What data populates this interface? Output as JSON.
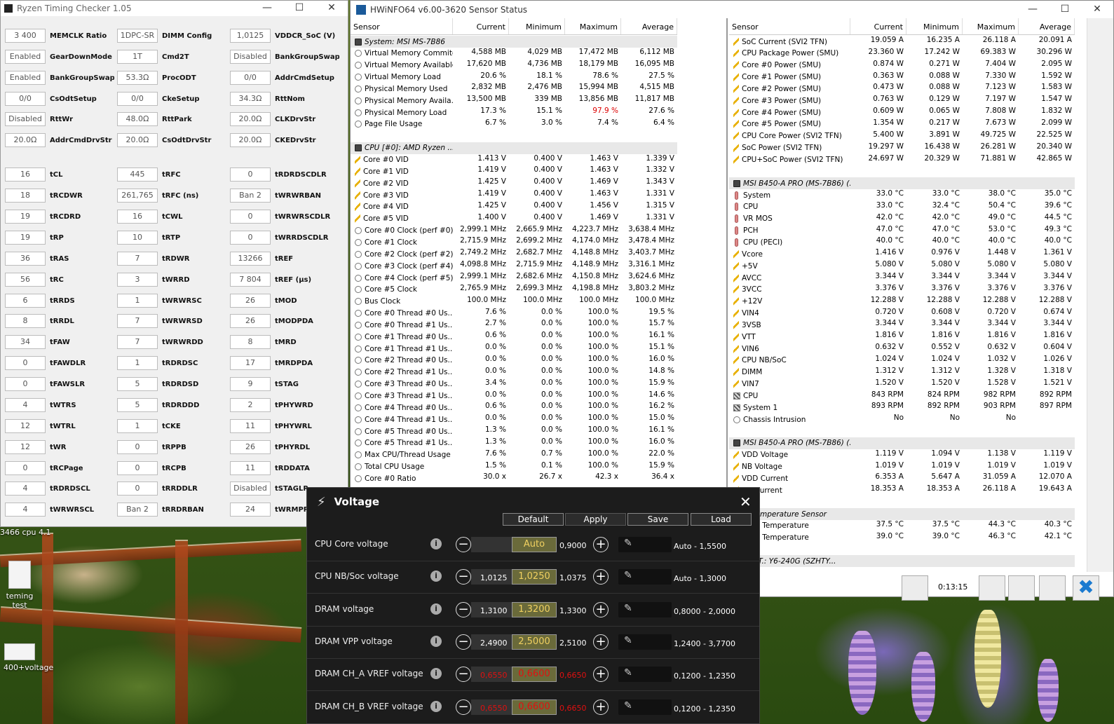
{
  "desktop": {
    "icons": [
      {
        "label": "teming test"
      },
      {
        "label": "400+voltage"
      }
    ],
    "caption": "3466 cpu 4.1"
  },
  "rtc": {
    "title": "Ryzen Timing Checker 1.05",
    "rows": [
      [
        [
          "3 400",
          "MEMCLK Ratio"
        ],
        [
          "1DPC-SR",
          "DIMM Config"
        ],
        [
          "1,0125",
          "VDDCR_SoC (V)"
        ]
      ],
      [
        [
          "Enabled",
          "GearDownMode"
        ],
        [
          "1T",
          "Cmd2T"
        ],
        [
          "Disabled",
          "BankGroupSwap"
        ]
      ],
      [
        [
          "Enabled",
          "BankGroupSwapAlt"
        ],
        [
          "53.3Ω",
          "ProcODT"
        ],
        [
          "0/0",
          "AddrCmdSetup"
        ]
      ],
      [
        [
          "0/0",
          "CsOdtSetup"
        ],
        [
          "0/0",
          "CkeSetup"
        ],
        [
          "34.3Ω",
          "RttNom"
        ]
      ],
      [
        [
          "Disabled",
          "RttWr"
        ],
        [
          "48.0Ω",
          "RttPark"
        ],
        [
          "20.0Ω",
          "CLKDrvStr"
        ]
      ],
      [
        [
          "20.0Ω",
          "AddrCmdDrvStr"
        ],
        [
          "20.0Ω",
          "CsOdtDrvStr"
        ],
        [
          "20.0Ω",
          "CKEDrvStr"
        ]
      ],
      [
        [
          "16",
          "tCL"
        ],
        [
          "445",
          "tRFC"
        ],
        [
          "0",
          "tRDRDSCDLR"
        ]
      ],
      [
        [
          "18",
          "tRCDWR"
        ],
        [
          "261,765",
          "tRFC (ns)"
        ],
        [
          "Ban 2",
          "tWRWRBAN"
        ]
      ],
      [
        [
          "19",
          "tRCDRD"
        ],
        [
          "16",
          "tCWL"
        ],
        [
          "0",
          "tWRWRSCDLR"
        ]
      ],
      [
        [
          "19",
          "tRP"
        ],
        [
          "10",
          "tRTP"
        ],
        [
          "0",
          "tWRRDSCDLR"
        ]
      ],
      [
        [
          "36",
          "tRAS"
        ],
        [
          "7",
          "tRDWR"
        ],
        [
          "13266",
          "tREF"
        ]
      ],
      [
        [
          "56",
          "tRC"
        ],
        [
          "3",
          "tWRRD"
        ],
        [
          "7 804",
          "tREF (µs)"
        ]
      ],
      [
        [
          "6",
          "tRRDS"
        ],
        [
          "1",
          "tWRWRSC"
        ],
        [
          "26",
          "tMOD"
        ]
      ],
      [
        [
          "8",
          "tRRDL"
        ],
        [
          "7",
          "tWRWRSD"
        ],
        [
          "26",
          "tMODPDA"
        ]
      ],
      [
        [
          "34",
          "tFAW"
        ],
        [
          "7",
          "tWRWRDD"
        ],
        [
          "8",
          "tMRD"
        ]
      ],
      [
        [
          "0",
          "tFAWDLR"
        ],
        [
          "1",
          "tRDRDSC"
        ],
        [
          "17",
          "tMRDPDA"
        ]
      ],
      [
        [
          "0",
          "tFAWSLR"
        ],
        [
          "5",
          "tRDRDSD"
        ],
        [
          "9",
          "tSTAG"
        ]
      ],
      [
        [
          "4",
          "tWTRS"
        ],
        [
          "5",
          "tRDRDDD"
        ],
        [
          "2",
          "tPHYWRD"
        ]
      ],
      [
        [
          "12",
          "tWTRL"
        ],
        [
          "1",
          "tCKE"
        ],
        [
          "11",
          "tPHYWRL"
        ]
      ],
      [
        [
          "12",
          "tWR"
        ],
        [
          "0",
          "tRPPB"
        ],
        [
          "26",
          "tPHYRDL"
        ]
      ],
      [
        [
          "0",
          "tRCPage"
        ],
        [
          "0",
          "tRCPB"
        ],
        [
          "11",
          "tRDDATA"
        ]
      ],
      [
        [
          "4",
          "tRDRDSCL"
        ],
        [
          "0",
          "tRRDDLR"
        ],
        [
          "Disabled",
          "tSTAGLR"
        ]
      ],
      [
        [
          "4",
          "tWRWRSCL"
        ],
        [
          "Ban 2",
          "tRRDRBAN"
        ],
        [
          "24",
          "tWRMPR"
        ]
      ]
    ]
  },
  "hw": {
    "title": "HWiNFO64 v6.00-3620 Sensor Status",
    "headers": [
      "Sensor",
      "Current",
      "Minimum",
      "Maximum",
      "Average"
    ],
    "left": [
      {
        "g": 1,
        "n": "System: MSI MS-7B86"
      },
      {
        "i": "c",
        "n": "Virtual Memory Commited",
        "v": [
          "4,588 MB",
          "4,029 MB",
          "17,472 MB",
          "6,112 MB"
        ]
      },
      {
        "i": "c",
        "n": "Virtual Memory Available",
        "v": [
          "17,620 MB",
          "4,736 MB",
          "18,179 MB",
          "16,095 MB"
        ]
      },
      {
        "i": "c",
        "n": "Virtual Memory Load",
        "v": [
          "20.6 %",
          "18.1 %",
          "78.6 %",
          "27.5 %"
        ]
      },
      {
        "i": "c",
        "n": "Physical Memory Used",
        "v": [
          "2,832 MB",
          "2,476 MB",
          "15,994 MB",
          "4,515 MB"
        ]
      },
      {
        "i": "c",
        "n": "Physical Memory Availa...",
        "v": [
          "13,500 MB",
          "339 MB",
          "13,856 MB",
          "11,817 MB"
        ]
      },
      {
        "i": "c",
        "n": "Physical Memory Load",
        "v": [
          "17.3 %",
          "15.1 %",
          "97.9 %",
          "27.6 %"
        ],
        "r": 2
      },
      {
        "i": "c",
        "n": "Page File Usage",
        "v": [
          "6.7 %",
          "3.0 %",
          "7.4 %",
          "6.4 %"
        ]
      },
      {
        "e": 1
      },
      {
        "g": 1,
        "n": "CPU [#0]: AMD Ryzen ..."
      },
      {
        "i": "v",
        "n": "Core #0 VID",
        "v": [
          "1.413 V",
          "0.400 V",
          "1.463 V",
          "1.339 V"
        ]
      },
      {
        "i": "v",
        "n": "Core #1 VID",
        "v": [
          "1.419 V",
          "0.400 V",
          "1.463 V",
          "1.332 V"
        ]
      },
      {
        "i": "v",
        "n": "Core #2 VID",
        "v": [
          "1.425 V",
          "0.400 V",
          "1.469 V",
          "1.343 V"
        ]
      },
      {
        "i": "v",
        "n": "Core #3 VID",
        "v": [
          "1.419 V",
          "0.400 V",
          "1.463 V",
          "1.331 V"
        ]
      },
      {
        "i": "v",
        "n": "Core #4 VID",
        "v": [
          "1.425 V",
          "0.400 V",
          "1.456 V",
          "1.315 V"
        ]
      },
      {
        "i": "v",
        "n": "Core #5 VID",
        "v": [
          "1.400 V",
          "0.400 V",
          "1.469 V",
          "1.331 V"
        ]
      },
      {
        "i": "c",
        "n": "Core #0 Clock (perf #0)",
        "v": [
          "2,999.1 MHz",
          "2,665.9 MHz",
          "4,223.7 MHz",
          "3,638.4 MHz"
        ]
      },
      {
        "i": "c",
        "n": "Core #1 Clock",
        "v": [
          "2,715.9 MHz",
          "2,699.2 MHz",
          "4,174.0 MHz",
          "3,478.4 MHz"
        ]
      },
      {
        "i": "c",
        "n": "Core #2 Clock (perf #2)",
        "v": [
          "2,749.2 MHz",
          "2,682.7 MHz",
          "4,148.8 MHz",
          "3,403.7 MHz"
        ]
      },
      {
        "i": "c",
        "n": "Core #3 Clock (perf #4)",
        "v": [
          "4,098.8 MHz",
          "2,715.9 MHz",
          "4,148.9 MHz",
          "3,316.1 MHz"
        ]
      },
      {
        "i": "c",
        "n": "Core #4 Clock (perf #5)",
        "v": [
          "2,999.1 MHz",
          "2,682.6 MHz",
          "4,150.8 MHz",
          "3,624.6 MHz"
        ]
      },
      {
        "i": "c",
        "n": "Core #5 Clock",
        "v": [
          "2,765.9 MHz",
          "2,699.3 MHz",
          "4,198.8 MHz",
          "3,803.2 MHz"
        ]
      },
      {
        "i": "c",
        "n": "Bus Clock",
        "v": [
          "100.0 MHz",
          "100.0 MHz",
          "100.0 MHz",
          "100.0 MHz"
        ]
      },
      {
        "i": "c",
        "n": "Core #0 Thread #0 Us...",
        "v": [
          "7.6 %",
          "0.0 %",
          "100.0 %",
          "19.5 %"
        ]
      },
      {
        "i": "c",
        "n": "Core #0 Thread #1 Us...",
        "v": [
          "2.7 %",
          "0.0 %",
          "100.0 %",
          "15.7 %"
        ]
      },
      {
        "i": "c",
        "n": "Core #1 Thread #0 Us...",
        "v": [
          "0.6 %",
          "0.0 %",
          "100.0 %",
          "16.1 %"
        ]
      },
      {
        "i": "c",
        "n": "Core #1 Thread #1 Us...",
        "v": [
          "0.0 %",
          "0.0 %",
          "100.0 %",
          "15.1 %"
        ]
      },
      {
        "i": "c",
        "n": "Core #2 Thread #0 Us...",
        "v": [
          "0.0 %",
          "0.0 %",
          "100.0 %",
          "16.0 %"
        ]
      },
      {
        "i": "c",
        "n": "Core #2 Thread #1 Us...",
        "v": [
          "0.0 %",
          "0.0 %",
          "100.0 %",
          "14.8 %"
        ]
      },
      {
        "i": "c",
        "n": "Core #3 Thread #0 Us...",
        "v": [
          "3.4 %",
          "0.0 %",
          "100.0 %",
          "15.9 %"
        ]
      },
      {
        "i": "c",
        "n": "Core #3 Thread #1 Us...",
        "v": [
          "0.0 %",
          "0.0 %",
          "100.0 %",
          "14.6 %"
        ]
      },
      {
        "i": "c",
        "n": "Core #4 Thread #0 Us...",
        "v": [
          "0.6 %",
          "0.0 %",
          "100.0 %",
          "16.2 %"
        ]
      },
      {
        "i": "c",
        "n": "Core #4 Thread #1 Us...",
        "v": [
          "0.0 %",
          "0.0 %",
          "100.0 %",
          "15.0 %"
        ]
      },
      {
        "i": "c",
        "n": "Core #5 Thread #0 Us...",
        "v": [
          "1.3 %",
          "0.0 %",
          "100.0 %",
          "16.1 %"
        ]
      },
      {
        "i": "c",
        "n": "Core #5 Thread #1 Us...",
        "v": [
          "1.3 %",
          "0.0 %",
          "100.0 %",
          "16.0 %"
        ]
      },
      {
        "i": "c",
        "n": "Max CPU/Thread Usage",
        "v": [
          "7.6 %",
          "0.7 %",
          "100.0 %",
          "22.0 %"
        ]
      },
      {
        "i": "c",
        "n": "Total CPU Usage",
        "v": [
          "1.5 %",
          "0.1 %",
          "100.0 %",
          "15.9 %"
        ]
      },
      {
        "i": "c",
        "n": "Core #0 Ratio",
        "v": [
          "30.0 x",
          "26.7 x",
          "42.3 x",
          "36.4 x"
        ]
      }
    ],
    "right": [
      {
        "i": "v",
        "n": "SoC Current (SVI2 TFN)",
        "v": [
          "19.059 A",
          "16.235 A",
          "26.118 A",
          "20.091 A"
        ]
      },
      {
        "i": "v",
        "n": "CPU Package Power (SMU)",
        "v": [
          "23.360 W",
          "17.242 W",
          "69.383 W",
          "30.296 W"
        ]
      },
      {
        "i": "v",
        "n": "Core #0 Power (SMU)",
        "v": [
          "0.874 W",
          "0.271 W",
          "7.404 W",
          "2.095 W"
        ]
      },
      {
        "i": "v",
        "n": "Core #1 Power (SMU)",
        "v": [
          "0.363 W",
          "0.088 W",
          "7.330 W",
          "1.592 W"
        ]
      },
      {
        "i": "v",
        "n": "Core #2 Power (SMU)",
        "v": [
          "0.473 W",
          "0.088 W",
          "7.123 W",
          "1.583 W"
        ]
      },
      {
        "i": "v",
        "n": "Core #3 Power (SMU)",
        "v": [
          "0.763 W",
          "0.129 W",
          "7.197 W",
          "1.547 W"
        ]
      },
      {
        "i": "v",
        "n": "Core #4 Power (SMU)",
        "v": [
          "0.609 W",
          "0.065 W",
          "7.808 W",
          "1.832 W"
        ]
      },
      {
        "i": "v",
        "n": "Core #5 Power (SMU)",
        "v": [
          "1.354 W",
          "0.217 W",
          "7.673 W",
          "2.099 W"
        ]
      },
      {
        "i": "v",
        "n": "CPU Core Power (SVI2 TFN)",
        "v": [
          "5.400 W",
          "3.891 W",
          "49.725 W",
          "22.525 W"
        ]
      },
      {
        "i": "v",
        "n": "SoC Power (SVI2 TFN)",
        "v": [
          "19.297 W",
          "16.438 W",
          "26.281 W",
          "20.340 W"
        ]
      },
      {
        "i": "v",
        "n": "CPU+SoC Power (SVI2 TFN)",
        "v": [
          "24.697 W",
          "20.329 W",
          "71.881 W",
          "42.865 W"
        ]
      },
      {
        "e": 1
      },
      {
        "g": 1,
        "n": "MSI B450-A PRO (MS-7B86) (..."
      },
      {
        "i": "t",
        "n": "System",
        "v": [
          "33.0 °C",
          "33.0 °C",
          "38.0 °C",
          "35.0 °C"
        ]
      },
      {
        "i": "t",
        "n": "CPU",
        "v": [
          "33.0 °C",
          "32.4 °C",
          "50.4 °C",
          "39.6 °C"
        ]
      },
      {
        "i": "t",
        "n": "VR MOS",
        "v": [
          "42.0 °C",
          "42.0 °C",
          "49.0 °C",
          "44.5 °C"
        ]
      },
      {
        "i": "t",
        "n": "PCH",
        "v": [
          "47.0 °C",
          "47.0 °C",
          "53.0 °C",
          "49.3 °C"
        ]
      },
      {
        "i": "t",
        "n": "CPU (PECI)",
        "v": [
          "40.0 °C",
          "40.0 °C",
          "40.0 °C",
          "40.0 °C"
        ]
      },
      {
        "i": "v",
        "n": "Vcore",
        "v": [
          "1.416 V",
          "0.976 V",
          "1.448 V",
          "1.361 V"
        ]
      },
      {
        "i": "v",
        "n": "+5V",
        "v": [
          "5.080 V",
          "5.080 V",
          "5.080 V",
          "5.080 V"
        ]
      },
      {
        "i": "v",
        "n": "AVCC",
        "v": [
          "3.344 V",
          "3.344 V",
          "3.344 V",
          "3.344 V"
        ]
      },
      {
        "i": "v",
        "n": "3VCC",
        "v": [
          "3.376 V",
          "3.376 V",
          "3.376 V",
          "3.376 V"
        ]
      },
      {
        "i": "v",
        "n": "+12V",
        "v": [
          "12.288 V",
          "12.288 V",
          "12.288 V",
          "12.288 V"
        ]
      },
      {
        "i": "v",
        "n": "VIN4",
        "v": [
          "0.720 V",
          "0.608 V",
          "0.720 V",
          "0.674 V"
        ]
      },
      {
        "i": "v",
        "n": "3VSB",
        "v": [
          "3.344 V",
          "3.344 V",
          "3.344 V",
          "3.344 V"
        ]
      },
      {
        "i": "v",
        "n": "VTT",
        "v": [
          "1.816 V",
          "1.816 V",
          "1.816 V",
          "1.816 V"
        ]
      },
      {
        "i": "v",
        "n": "VIN6",
        "v": [
          "0.632 V",
          "0.552 V",
          "0.632 V",
          "0.604 V"
        ]
      },
      {
        "i": "v",
        "n": "CPU NB/SoC",
        "v": [
          "1.024 V",
          "1.024 V",
          "1.032 V",
          "1.026 V"
        ]
      },
      {
        "i": "v",
        "n": "DIMM",
        "v": [
          "1.312 V",
          "1.312 V",
          "1.328 V",
          "1.318 V"
        ]
      },
      {
        "i": "v",
        "n": "VIN7",
        "v": [
          "1.520 V",
          "1.520 V",
          "1.528 V",
          "1.521 V"
        ]
      },
      {
        "i": "f",
        "n": "CPU",
        "v": [
          "843 RPM",
          "824 RPM",
          "982 RPM",
          "892 RPM"
        ]
      },
      {
        "i": "f",
        "n": "System 1",
        "v": [
          "893 RPM",
          "892 RPM",
          "903 RPM",
          "897 RPM"
        ]
      },
      {
        "i": "c",
        "n": "Chassis Intrusion",
        "v": [
          "No",
          "No",
          "No",
          ""
        ]
      },
      {
        "e": 1
      },
      {
        "g": 1,
        "n": "MSI B450-A PRO (MS-7B86) (..."
      },
      {
        "i": "v",
        "n": "VDD Voltage",
        "v": [
          "1.119 V",
          "1.094 V",
          "1.138 V",
          "1.119 V"
        ]
      },
      {
        "i": "v",
        "n": "NB Voltage",
        "v": [
          "1.019 V",
          "1.019 V",
          "1.019 V",
          "1.019 V"
        ]
      },
      {
        "i": "v",
        "n": "VDD Current",
        "v": [
          "6.353 A",
          "5.647 A",
          "31.059 A",
          "12.070 A"
        ]
      },
      {
        "i": "v",
        "n": "NB Current",
        "v": [
          "18.353 A",
          "18.353 A",
          "26.118 A",
          "19.643 A"
        ]
      },
      {
        "e": 1
      },
      {
        "g": 1,
        "n": "M Temperature Sensor"
      },
      {
        "i": "t",
        "n": "M[2] Temperature",
        "v": [
          "37.5 °C",
          "37.5 °C",
          "44.3 °C",
          "40.3 °C"
        ]
      },
      {
        "i": "t",
        "n": "M[3] Temperature",
        "v": [
          "39.0 °C",
          "39.0 °C",
          "46.3 °C",
          "42.1 °C"
        ]
      },
      {
        "e": 1
      },
      {
        "g": 1,
        "n": "A.R.T.: Y6-240G (SZHTY..."
      }
    ],
    "timer": "0:13:15"
  },
  "volt": {
    "title": "Voltage",
    "buttons": [
      "Default",
      "Apply",
      "Save",
      "Load"
    ],
    "rows": [
      {
        "label": "CPU Core voltage",
        "lo": "",
        "cur": "Auto",
        "hi": "0,9000",
        "range": "Auto - 1,5500"
      },
      {
        "label": "CPU NB/Soc voltage",
        "lo": "1,0125",
        "cur": "1,0250",
        "hi": "1,0375",
        "range": "Auto - 1,3000"
      },
      {
        "label": "DRAM voltage",
        "lo": "1,3100",
        "cur": "1,3200",
        "hi": "1,3300",
        "range": "0,8000 - 2,0000"
      },
      {
        "label": "DRAM VPP voltage",
        "lo": "2,4900",
        "cur": "2,5000",
        "hi": "2,5100",
        "range": "1,2400 - 3,7700"
      },
      {
        "label": "DRAM CH_A VREF voltage",
        "lo": "0,6550",
        "cur": "0,6600",
        "hi": "0,6650",
        "range": "0,1200 - 1,2350",
        "red": true
      },
      {
        "label": "DRAM CH_B VREF voltage",
        "lo": "0,6550",
        "cur": "0,6600",
        "hi": "0,6650",
        "range": "0,1200 - 1,2350",
        "red": true
      }
    ]
  }
}
